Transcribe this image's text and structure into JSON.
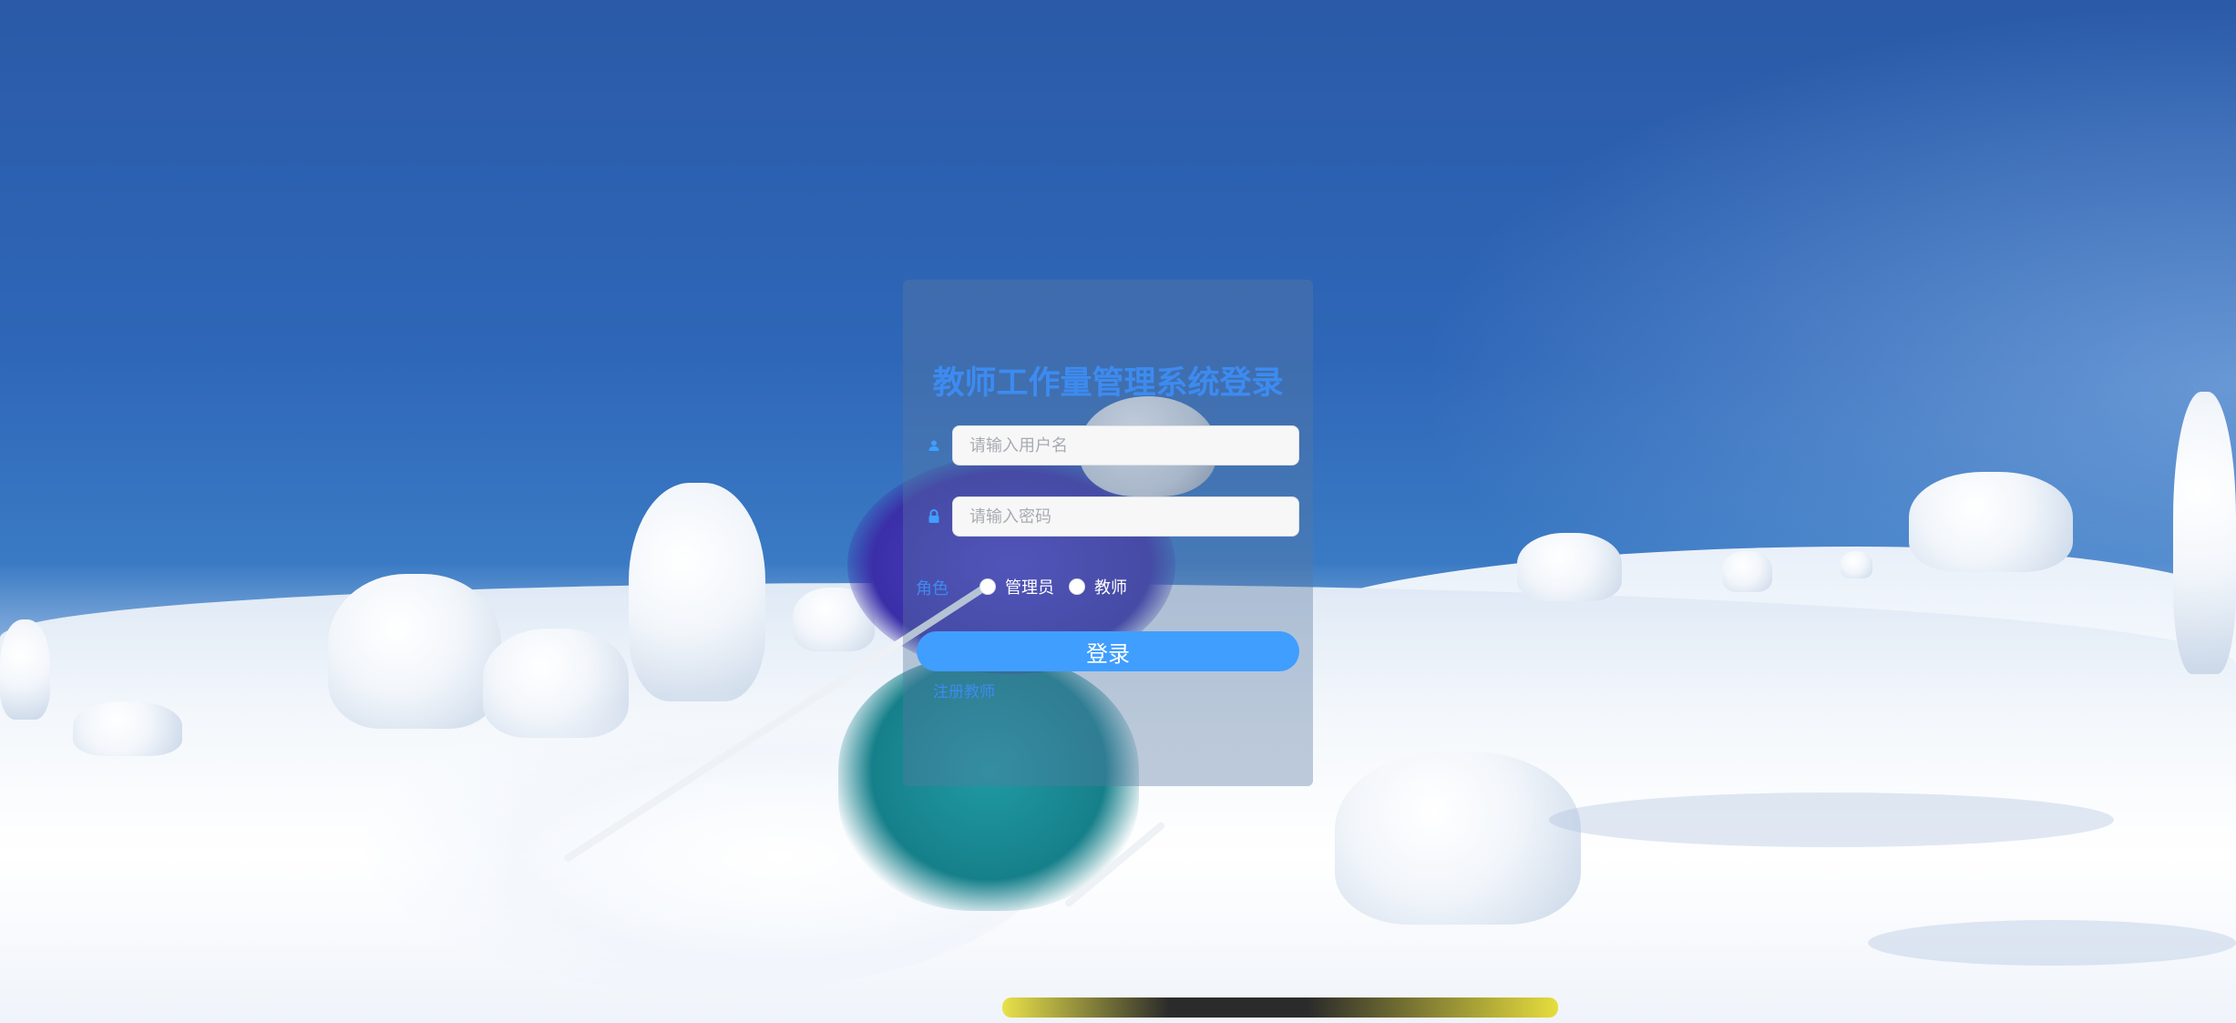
{
  "login": {
    "title": "教师工作量管理系统登录",
    "username_placeholder": "请输入用户名",
    "password_placeholder": "请输入密码",
    "role_label": "角色",
    "role_options": [
      "管理员",
      "教师"
    ],
    "submit_label": "登录",
    "register_link": "注册教师"
  },
  "icons": {
    "username": "user-icon",
    "password": "lock-icon"
  },
  "colors": {
    "accent": "#409eff",
    "title": "#3d8bf0",
    "panel": "rgba(90,120,160,0.38)"
  }
}
